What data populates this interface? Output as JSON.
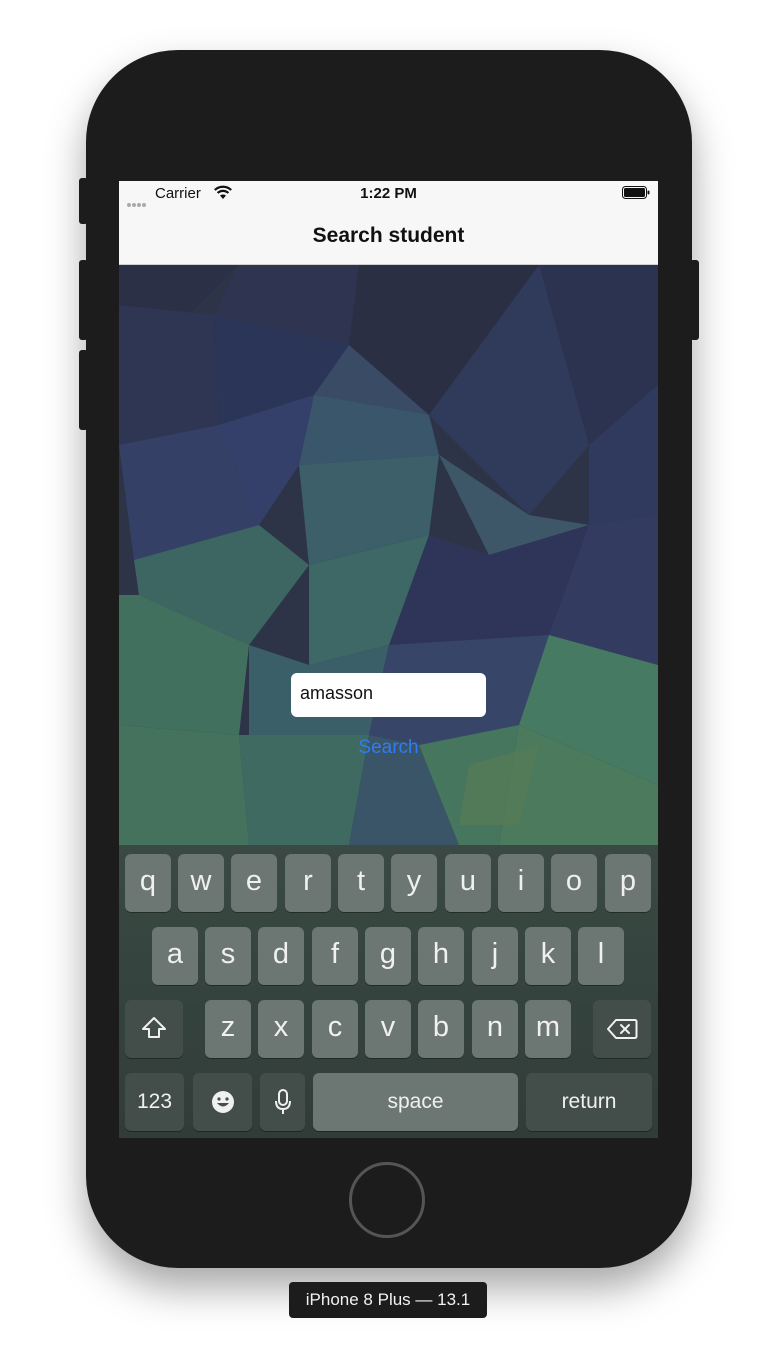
{
  "status_bar": {
    "carrier": "Carrier",
    "time": "1:22 PM",
    "icons": [
      "signal-icon",
      "wifi-icon",
      "battery-icon"
    ]
  },
  "nav": {
    "title": "Search student"
  },
  "search": {
    "input_value": "amasson",
    "button_label": "Search",
    "button_color": "#2f7cf6"
  },
  "keyboard": {
    "row1": [
      "q",
      "w",
      "e",
      "r",
      "t",
      "y",
      "u",
      "i",
      "o",
      "p"
    ],
    "row2": [
      "a",
      "s",
      "d",
      "f",
      "g",
      "h",
      "j",
      "k",
      "l"
    ],
    "row3": [
      "z",
      "x",
      "c",
      "v",
      "b",
      "n",
      "m"
    ],
    "numbers_label": "123",
    "space_label": "space",
    "return_label": "return",
    "icons": [
      "shift-icon",
      "backspace-icon",
      "emoji-icon",
      "microphone-icon"
    ]
  },
  "device_label": "iPhone 8 Plus — 13.1"
}
